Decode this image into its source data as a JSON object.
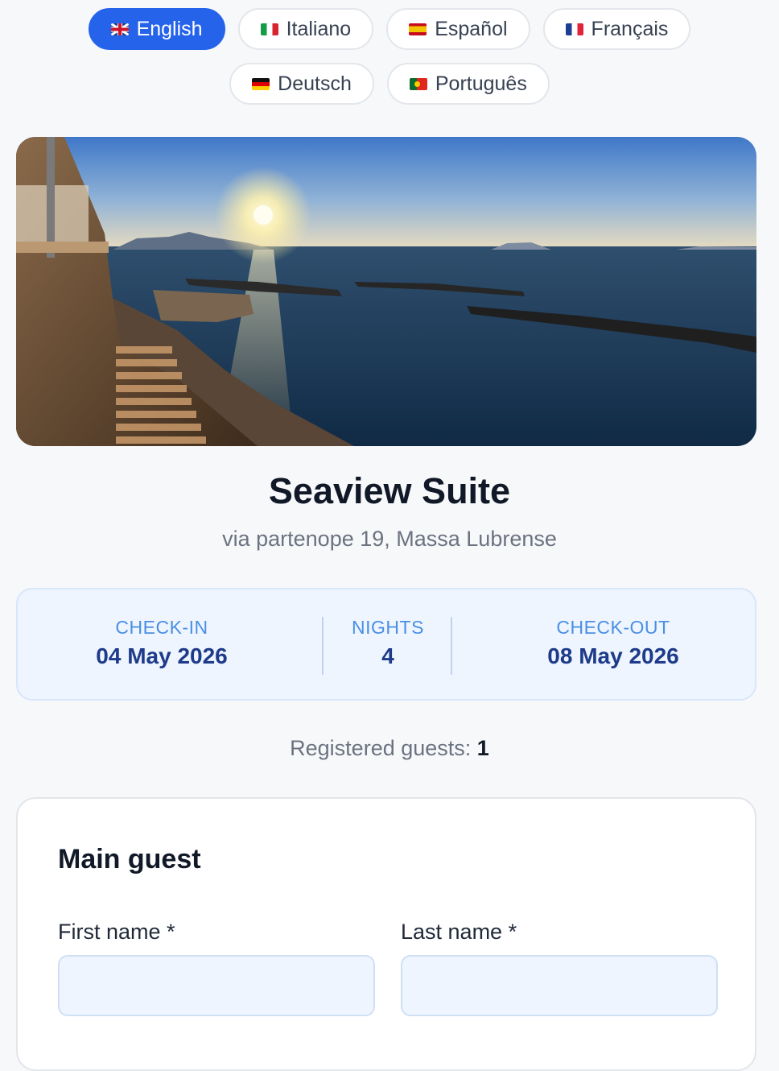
{
  "languages": [
    {
      "label": "English",
      "flag": "flag-gb",
      "active": true
    },
    {
      "label": "Italiano",
      "flag": "flag-it",
      "active": false
    },
    {
      "label": "Español",
      "flag": "flag-es",
      "active": false
    },
    {
      "label": "Français",
      "flag": "flag-fr",
      "active": false
    },
    {
      "label": "Deutsch",
      "flag": "flag-de",
      "active": false
    },
    {
      "label": "Português",
      "flag": "flag-pt",
      "active": false
    }
  ],
  "property": {
    "title": "Seaview Suite",
    "address": "via partenope 19, Massa Lubrense",
    "hero_image": "sunset-sea-view-photo"
  },
  "stay": {
    "checkin_label": "CHECK-IN",
    "checkin_value": "04 May 2026",
    "nights_label": "NIGHTS",
    "nights_value": "4",
    "checkout_label": "CHECK-OUT",
    "checkout_value": "08 May 2026"
  },
  "guests": {
    "label": "Registered guests:",
    "count": "1"
  },
  "form": {
    "section_title": "Main guest",
    "first_name_label": "First name *",
    "first_name_value": "",
    "last_name_label": "Last name *",
    "last_name_value": ""
  },
  "colors": {
    "accent": "#2563eb",
    "stay_label": "#4a8fe4",
    "stay_value": "#1e3a8a"
  }
}
